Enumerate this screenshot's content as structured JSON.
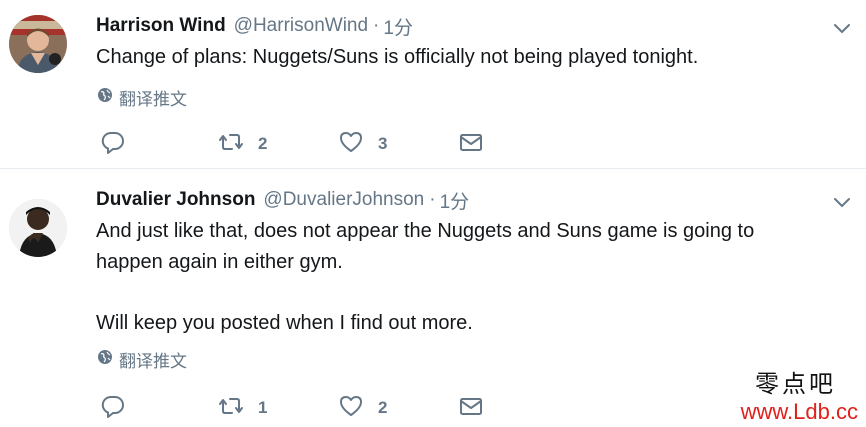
{
  "tweets": [
    {
      "fullname": "Harrison Wind",
      "username": "@HarrisonWind",
      "time": "1分",
      "text_lines": [
        "Change of plans: Nuggets/Suns is officially not being played tonight."
      ],
      "translate_label": "翻译推文",
      "retweets": "2",
      "likes": "3",
      "icons": {
        "avatar": "avatar-photo",
        "caret": "chevron-down-icon",
        "translate": "globe-icon",
        "reply": "reply-icon",
        "retweet": "retweet-icon",
        "like": "heart-icon",
        "dm": "envelope-icon"
      }
    },
    {
      "fullname": "Duvalier Johnson",
      "username": "@DuvalierJohnson",
      "time": "1分",
      "text_lines": [
        "And just like that, does not appear the Nuggets and Suns game is going to",
        "happen again in either gym.",
        "Will keep you posted when I find out more."
      ],
      "translate_label": "翻译推文",
      "retweets": "1",
      "likes": "2"
    }
  ],
  "watermark": {
    "name": "零点吧",
    "url": "www.Ldb.cc"
  },
  "colors": {
    "text": "#14171a",
    "secondary": "#657786",
    "divider": "#e6ecf0",
    "watermark_url": "#e0211b"
  }
}
